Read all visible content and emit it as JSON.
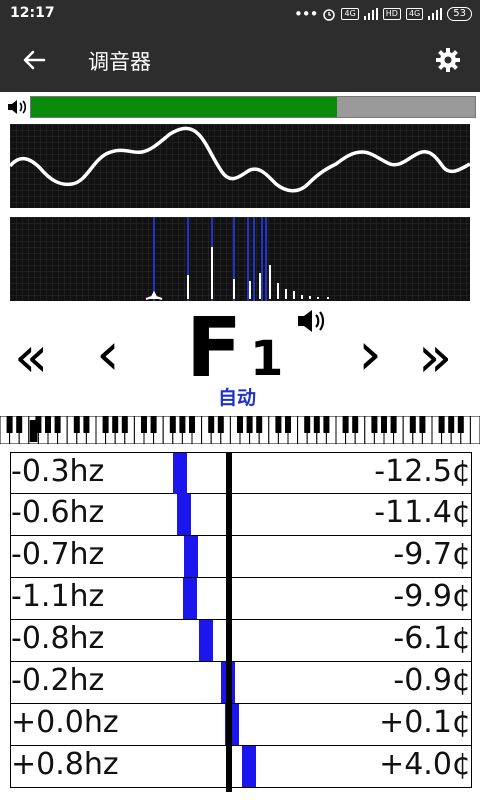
{
  "status": {
    "time": "12:17",
    "dots": "•••",
    "net1": "4G",
    "hd": "HD",
    "net2": "4G",
    "battery": "53"
  },
  "appbar": {
    "title": "调音器",
    "back_icon": "back-arrow-icon",
    "settings_icon": "gear-icon"
  },
  "level": {
    "fraction": 0.69,
    "fill_color": "#0a8a0a",
    "track_color": "#9a9a9a"
  },
  "waveform": {
    "background": "#111111",
    "trace_color": "#ffffff"
  },
  "spectrum": {
    "background": "#111111",
    "accent": "#2233cc",
    "peak_color": "#ffffff"
  },
  "tuner": {
    "prev_octave": "«",
    "prev_note": "‹",
    "note": "F",
    "octave": "1",
    "next_note": "›",
    "next_octave": "»",
    "mode": "自动",
    "mode_color": "#1f31c8"
  },
  "keyboard": {
    "highlighted_white_key": 3
  },
  "readings": [
    {
      "hz": "-0.3hz",
      "cents": "-12.5¢",
      "offset": -12.5
    },
    {
      "hz": "-0.6hz",
      "cents": "-11.4¢",
      "offset": -11.4
    },
    {
      "hz": "-0.7hz",
      "cents": "-9.7¢",
      "offset": -9.7
    },
    {
      "hz": "-1.1hz",
      "cents": "-9.9¢",
      "offset": -9.9
    },
    {
      "hz": "-0.8hz",
      "cents": "-6.1¢",
      "offset": -6.1
    },
    {
      "hz": "-0.2hz",
      "cents": "-0.9¢",
      "offset": -0.9
    },
    {
      "hz": "+0.0hz",
      "cents": "+0.1¢",
      "offset": 0.1
    },
    {
      "hz": "+0.8hz",
      "cents": "+4.0¢",
      "offset": 4.0
    }
  ]
}
